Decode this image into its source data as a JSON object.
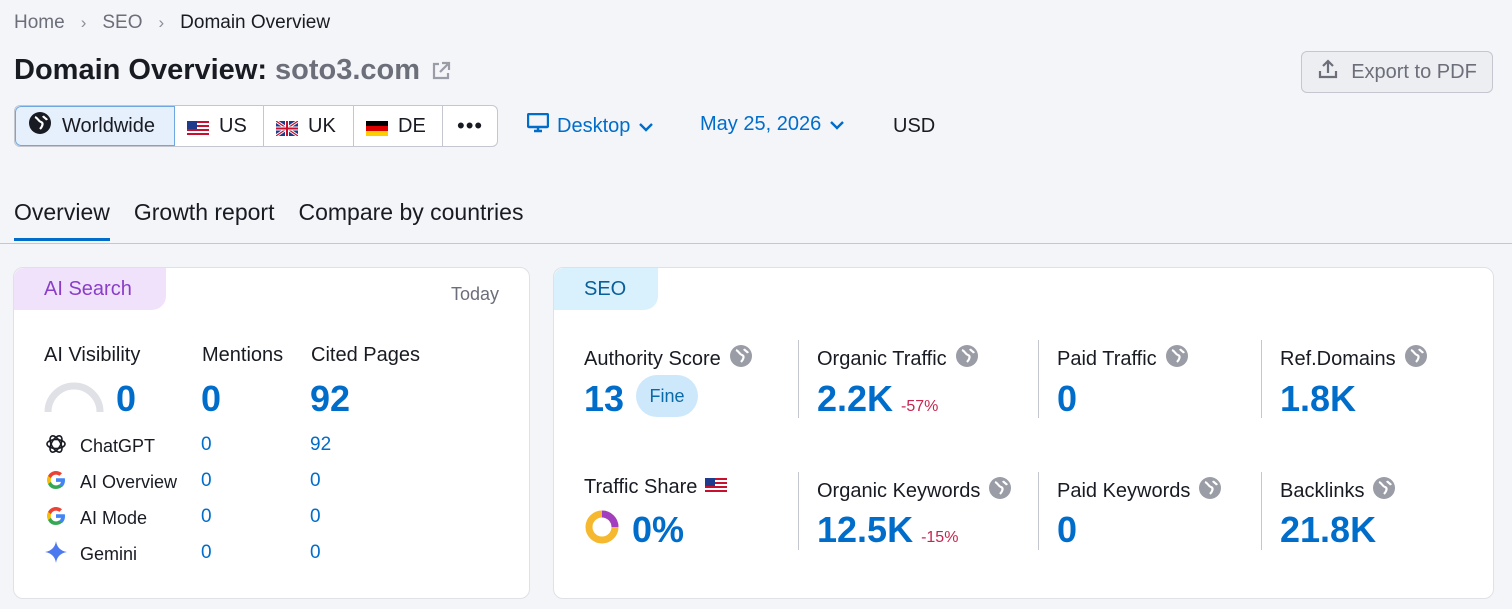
{
  "breadcrumb": {
    "home": "Home",
    "seo": "SEO",
    "current": "Domain Overview"
  },
  "header": {
    "title": "Domain Overview:",
    "domain": "soto3.com",
    "export_label": "Export to PDF"
  },
  "regions": [
    {
      "label": "Worldwide",
      "active": true
    },
    {
      "label": "US"
    },
    {
      "label": "UK"
    },
    {
      "label": "DE"
    }
  ],
  "filters": {
    "device": "Desktop",
    "date": "May 25, 2026",
    "currency": "USD"
  },
  "tabs": [
    {
      "label": "Overview",
      "active": true
    },
    {
      "label": "Growth report"
    },
    {
      "label": "Compare by countries"
    }
  ],
  "ai_search": {
    "tag": "AI Search",
    "period": "Today",
    "visibility_label": "AI Visibility",
    "visibility_value": "0",
    "mentions_label": "Mentions",
    "mentions_value": "0",
    "cited_label": "Cited Pages",
    "cited_value": "92",
    "engines": [
      {
        "name": "ChatGPT",
        "mentions": "0",
        "cited": "92"
      },
      {
        "name": "AI Overview",
        "mentions": "0",
        "cited": "0"
      },
      {
        "name": "AI Mode",
        "mentions": "0",
        "cited": "0"
      },
      {
        "name": "Gemini",
        "mentions": "0",
        "cited": "0"
      }
    ]
  },
  "seo": {
    "tag": "SEO",
    "authority_label": "Authority Score",
    "authority_value": "13",
    "authority_badge": "Fine",
    "organic_traffic_label": "Organic Traffic",
    "organic_traffic_value": "2.2K",
    "organic_traffic_delta": "-57%",
    "paid_traffic_label": "Paid Traffic",
    "paid_traffic_value": "0",
    "ref_domains_label": "Ref.Domains",
    "ref_domains_value": "1.8K",
    "traffic_share_label": "Traffic Share",
    "traffic_share_value": "0%",
    "organic_keywords_label": "Organic Keywords",
    "organic_keywords_value": "12.5K",
    "organic_keywords_delta": "-15%",
    "paid_keywords_label": "Paid Keywords",
    "paid_keywords_value": "0",
    "backlinks_label": "Backlinks",
    "backlinks_value": "21.8K"
  },
  "colors": {
    "accent": "#006dca",
    "negative": "#c7254e",
    "ai_tag": "#f0e2fb",
    "seo_tag": "#d9f0fd"
  }
}
